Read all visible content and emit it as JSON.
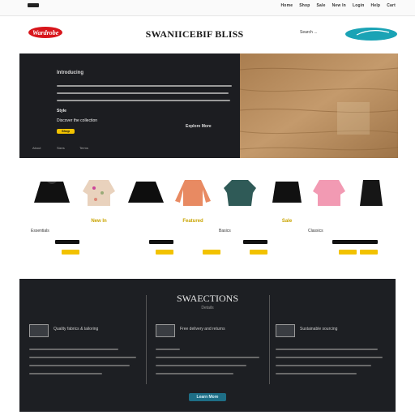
{
  "topnav": {
    "items": [
      "Home",
      "Shop",
      "Sale",
      "New In",
      "Login",
      "Help",
      "Cart"
    ]
  },
  "header": {
    "logo_text": "Wardrobe",
    "title": "SWANIICEBIF BLISS",
    "search_label": "Search ..."
  },
  "hero": {
    "kicker": "Introducing",
    "tag": "Style",
    "sub": "Discover the collection",
    "button_label": "Shop",
    "aside": "Explore More",
    "foot_links": [
      "About",
      "Sizes",
      "Terms"
    ]
  },
  "products": [
    {
      "title": "",
      "sub": "Essentials",
      "price": "",
      "color": "#111111",
      "shape": "cape"
    },
    {
      "title": "New In",
      "sub": "",
      "price": "",
      "color": "#e9d2bd",
      "shape": "jacket"
    },
    {
      "title": "",
      "sub": "",
      "price": "",
      "color": "#0e0e0e",
      "shape": "cape"
    },
    {
      "title": "Featured",
      "sub": "",
      "price": "",
      "color": "#e88a62",
      "shape": "shirt"
    },
    {
      "title": "",
      "sub": "Basics",
      "price": "",
      "color": "#2f5a57",
      "shape": "top"
    },
    {
      "title": "Sale",
      "sub": "",
      "price": "",
      "color": "#111111",
      "shape": "skirt"
    },
    {
      "title": "",
      "sub": "Classics",
      "price": "",
      "color": "#f29ab3",
      "shape": "jacket"
    },
    {
      "title": "",
      "sub": "",
      "price": "",
      "color": "#161616",
      "shape": "vest"
    }
  ],
  "features": {
    "title": "SWAECTIONS",
    "subtitle": "Details",
    "items": [
      {
        "head": "Quality fabrics & tailoring"
      },
      {
        "head": "Free delivery and returns"
      },
      {
        "head": "Sustainable sourcing"
      }
    ],
    "button_label": "Learn More"
  },
  "colors": {
    "accent": "#f2c200",
    "hero_dark": "#1c1d21",
    "button_teal": "#1e6e86",
    "logo_red": "#d8161c",
    "badge_teal": "#1aa3b5"
  }
}
